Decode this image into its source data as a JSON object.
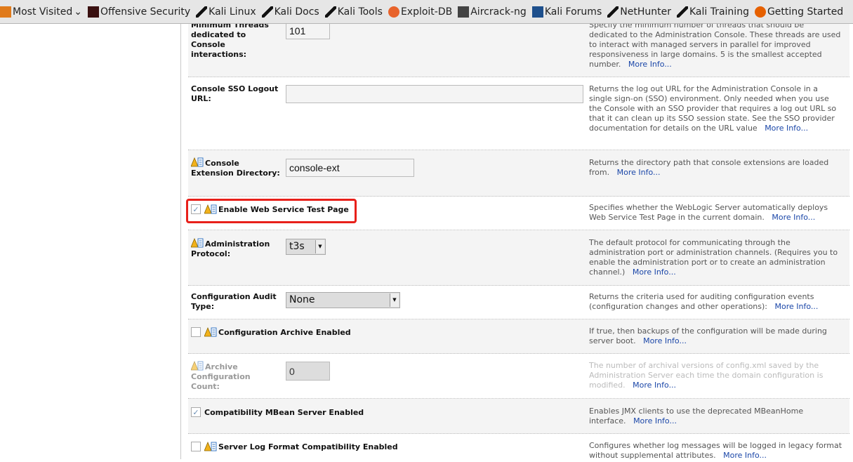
{
  "bookmarks": [
    {
      "label": "Most Visited",
      "icon": "folder-icon",
      "dropdown": true
    },
    {
      "label": "Offensive Security",
      "icon": "offsec-icon"
    },
    {
      "label": "Kali Linux",
      "icon": "kali-dragon-icon"
    },
    {
      "label": "Kali Docs",
      "icon": "kali-dragon-icon"
    },
    {
      "label": "Kali Tools",
      "icon": "kali-dragon-icon"
    },
    {
      "label": "Exploit-DB",
      "icon": "exploitdb-bug-icon"
    },
    {
      "label": "Aircrack-ng",
      "icon": "aircrack-icon"
    },
    {
      "label": "Kali Forums",
      "icon": "kali-forums-icon"
    },
    {
      "label": "NetHunter",
      "icon": "kali-dragon-icon"
    },
    {
      "label": "Kali Training",
      "icon": "kali-dragon-icon"
    },
    {
      "label": "Getting Started",
      "icon": "firefox-icon"
    }
  ],
  "more_info": "More Info...",
  "rows": [
    {
      "label": "Minimum Threads dedicated to Console interactions:",
      "value": "101",
      "desc": "Specify the minimum number of threads that should be dedicated to the Administration Console. These threads are used to interact with managed servers in parallel for improved responsiveness in large domains. 5 is the smallest accepted number."
    },
    {
      "label": "Console SSO Logout URL:",
      "value": "",
      "desc": "Returns the log out URL for the Administration Console in a single sign-on (SSO) environment. Only needed when you use the Console with an SSO provider that requires a log out URL so that it can clean up its SSO session state. See the SSO provider documentation for details on the URL value"
    },
    {
      "label": "Console Extension Directory:",
      "value": "console-ext",
      "desc": "Returns the directory path that console extensions are loaded from."
    },
    {
      "label": "Enable Web Service Test Page",
      "checked": true,
      "desc": "Specifies whether the WebLogic Server automatically deploys Web Service Test Page in the current domain."
    },
    {
      "label": "Administration Protocol:",
      "value": "t3s",
      "desc": "The default protocol for communicating through the administration port or administration channels. (Requires you to enable the administration port or to create an administration channel.)"
    },
    {
      "label": "Configuration Audit Type:",
      "value": "None",
      "desc": "Returns the criteria used for auditing configuration events (configuration changes and other operations):"
    },
    {
      "label": "Configuration Archive Enabled",
      "checked": false,
      "desc": "If true, then backups of the configuration will be made during server boot."
    },
    {
      "label": "Archive Configuration Count:",
      "value": "0",
      "desc": "The number of archival versions of config.xml saved by the Administration Server each time the domain configuration is modified.",
      "disabled": true
    },
    {
      "label": "Compatibility MBean Server Enabled",
      "checked": true,
      "desc": "Enables JMX clients to use the deprecated MBeanHome interface."
    },
    {
      "label": "Server Log Format Compatibility Enabled",
      "checked": false,
      "desc": "Configures whether log messages will be logged in legacy format without supplemental attributes."
    }
  ],
  "colors": {
    "highlight": "#e8201a",
    "link": "#1a46a8"
  }
}
